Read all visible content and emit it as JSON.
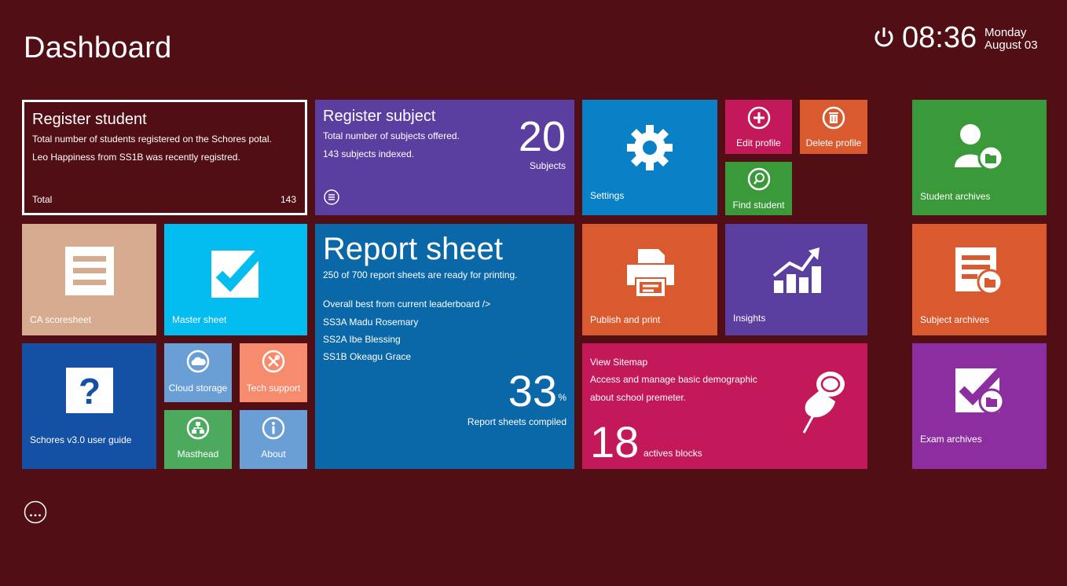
{
  "header": {
    "title": "Dashboard",
    "time": "08:36",
    "day": "Monday",
    "date": "August 03"
  },
  "tiles": {
    "register_student": {
      "title": "Register student",
      "line1": "Total number of students registered on the Schores potal.",
      "line2": "Leo Happiness from SS1B was recently registred.",
      "total_label": "Total",
      "total_value": "143"
    },
    "register_subject": {
      "title": "Register subject",
      "line1": "Total number of subjects offered.",
      "line2": "143 subjects indexed.",
      "count": "20",
      "count_label": "Subjects"
    },
    "settings": {
      "label": "Settings"
    },
    "edit_profile": {
      "label": "Edit profile"
    },
    "delete_profile": {
      "label": "Delete profile"
    },
    "find_student": {
      "label": "Find student"
    },
    "student_archives": {
      "label": "Student archives"
    },
    "ca_scoresheet": {
      "label": "CA scoresheet"
    },
    "master_sheet": {
      "label": "Master sheet"
    },
    "report_sheet": {
      "title": "Report sheet",
      "subtitle": "250 of 700 report sheets are ready for printing.",
      "leader_heading": "Overall best from current leaderboard />",
      "leaders": [
        "SS3A Madu Rosemary",
        "SS2A Ibe Blessing",
        "SS1B Okeagu Grace"
      ],
      "percent": "33",
      "percent_sign": "%",
      "compiled_label": "Report sheets compiled"
    },
    "publish_print": {
      "label": "Publish and print"
    },
    "insights": {
      "label": "Insights"
    },
    "subject_archives": {
      "label": "Subject archives"
    },
    "user_guide": {
      "label": "Schores v3.0 user guide"
    },
    "cloud_storage": {
      "label": "Cloud storage"
    },
    "tech_support": {
      "label": "Tech support"
    },
    "masthead": {
      "label": "Masthead"
    },
    "about": {
      "label": "About"
    },
    "sitemap": {
      "title": "View Sitemap",
      "line1": "Access and manage basic demographic",
      "line2": "about school premeter.",
      "count": "18",
      "count_label": "actives blocks"
    },
    "exam_archives": {
      "label": "Exam archives"
    }
  },
  "colors": {
    "background": "#520e15",
    "purple": "#5b3fa0",
    "blue": "#0a80c6",
    "magenta": "#c3185a",
    "orange": "#da5a30",
    "green": "#3a9a3a",
    "tan": "#d6ab90",
    "cyan": "#03bdf0",
    "navy": "#1450a4",
    "report_blue": "#0b68a8",
    "violet": "#8c2ea0"
  },
  "icons": [
    "power-icon",
    "gear-icon",
    "plus-circle-icon",
    "trash-icon",
    "search-icon",
    "user-folder-icon",
    "list-icon",
    "checkmark-icon",
    "printer-icon",
    "chart-icon",
    "sheet-folder-icon",
    "question-icon",
    "cloud-icon",
    "tools-icon",
    "network-icon",
    "info-icon",
    "pushpin-icon",
    "check-folder-icon",
    "menu-icon",
    "more-icon"
  ]
}
